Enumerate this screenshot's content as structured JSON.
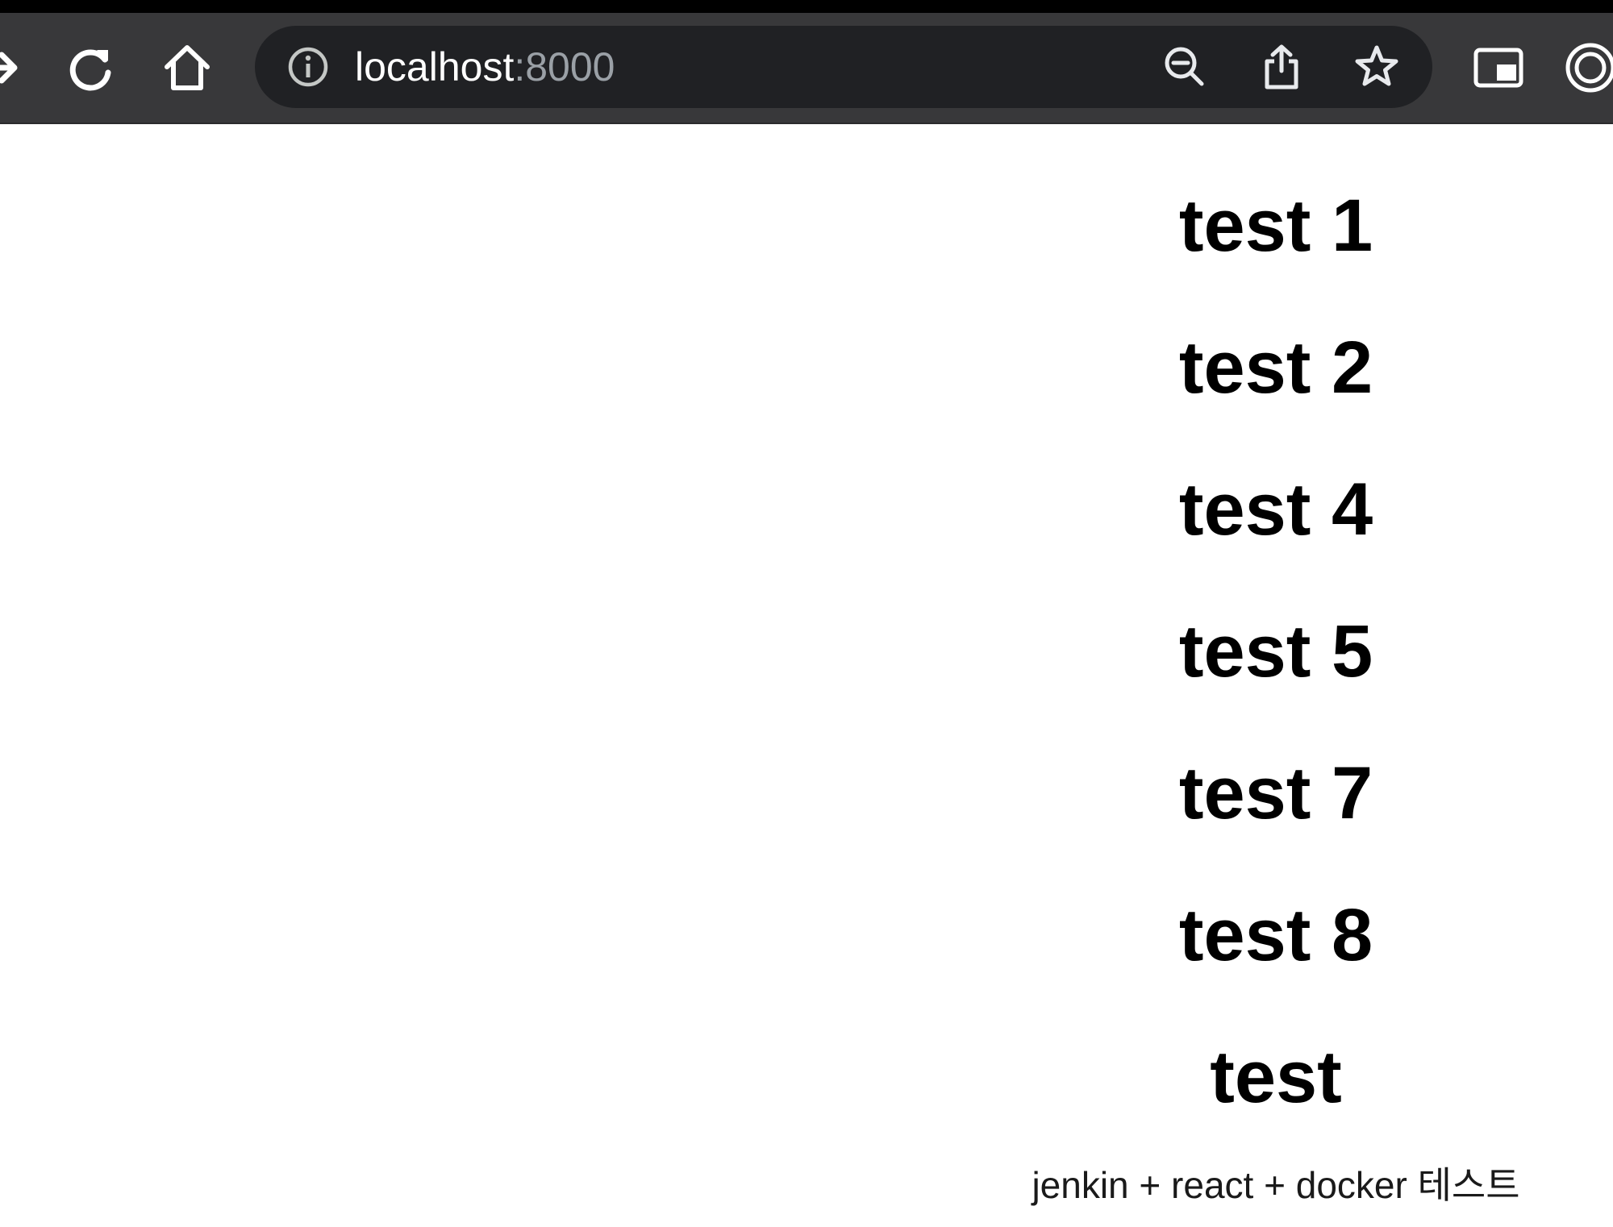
{
  "browser": {
    "url_host": "localhost",
    "url_port": ":8000",
    "icons": {
      "forward": "forward-arrow-icon",
      "reload": "reload-icon",
      "home": "home-icon",
      "site_info": "info-icon",
      "zoom": "zoom-out-icon",
      "share": "share-icon",
      "bookmark": "star-icon",
      "pip": "picture-in-picture-icon",
      "extension": "circle-target-icon"
    },
    "colors": {
      "toolbar": "#38383a",
      "omnibox": "#202124",
      "port_text": "#9aa0a6"
    }
  },
  "page": {
    "headings": [
      "test 1",
      "test 2",
      "test 4",
      "test 5",
      "test 7",
      "test 8",
      "test"
    ],
    "footer": "jenkin + react + docker 테스트"
  }
}
